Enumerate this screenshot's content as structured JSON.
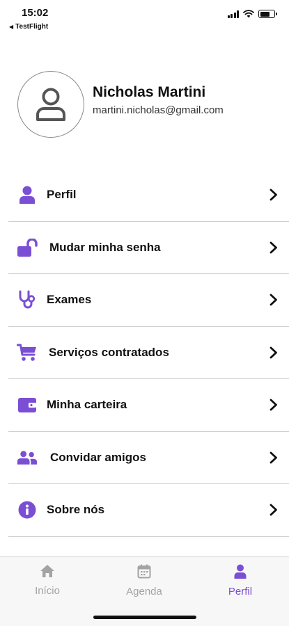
{
  "status_bar": {
    "time": "15:02",
    "back_app": "TestFlight"
  },
  "profile": {
    "name": "Nicholas Martini",
    "email": "martini.nicholas@gmail.com"
  },
  "menu": {
    "items": [
      {
        "label": "Perfil",
        "icon": "person-icon"
      },
      {
        "label": "Mudar minha senha",
        "icon": "unlock-icon"
      },
      {
        "label": "Exames",
        "icon": "stethoscope-icon"
      },
      {
        "label": "Serviços contratados",
        "icon": "cart-icon"
      },
      {
        "label": "Minha carteira",
        "icon": "wallet-icon"
      },
      {
        "label": "Convidar amigos",
        "icon": "people-icon"
      },
      {
        "label": "Sobre nós",
        "icon": "info-icon"
      }
    ]
  },
  "tab_bar": {
    "tabs": [
      {
        "label": "Início",
        "icon": "home-icon",
        "active": false
      },
      {
        "label": "Agenda",
        "icon": "calendar-icon",
        "active": false
      },
      {
        "label": "Perfil",
        "icon": "person-icon",
        "active": true
      }
    ]
  },
  "colors": {
    "accent": "#7b4fd4",
    "inactive": "#a3a3a3",
    "divider": "#cfcfcf"
  }
}
